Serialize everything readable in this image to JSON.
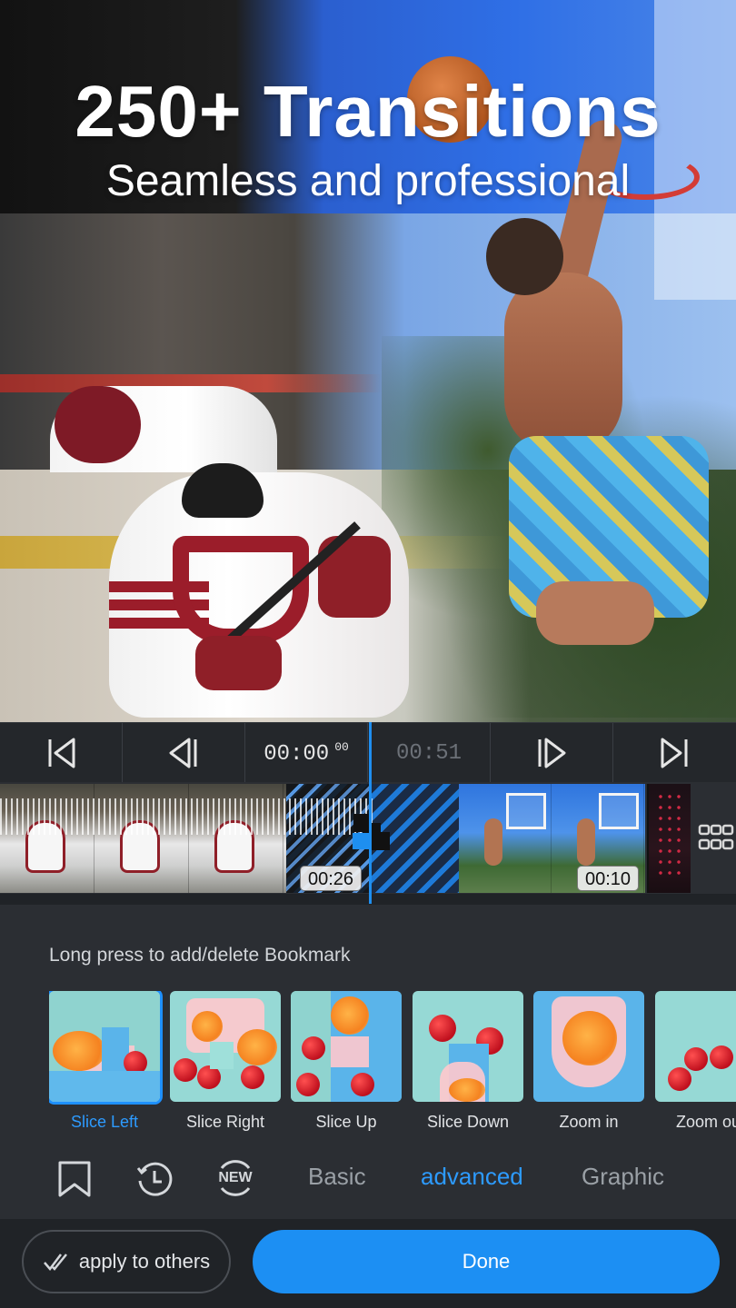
{
  "hero": {
    "title": "250+ Transitions",
    "subtitle": "Seamless and professional"
  },
  "playback": {
    "current_time": "00:00",
    "current_frames": "00",
    "duration": "00:51",
    "icons": [
      "skip-to-start-icon",
      "prev-frame-icon",
      "next-frame-icon",
      "skip-to-end-icon"
    ]
  },
  "timeline": {
    "clip1_duration": "00:26",
    "clip2_duration": "00:10"
  },
  "panel": {
    "hint": "Long press to add/delete Bookmark",
    "transitions": [
      {
        "label": "Slice Left",
        "selected": true
      },
      {
        "label": "Slice Right",
        "selected": false
      },
      {
        "label": "Slice Up",
        "selected": false
      },
      {
        "label": "Slice Down",
        "selected": false
      },
      {
        "label": "Zoom in",
        "selected": false
      },
      {
        "label": "Zoom out",
        "selected": false
      }
    ],
    "new_badge": "NEW",
    "categories": [
      {
        "label": "Basic",
        "active": false
      },
      {
        "label": "advanced",
        "active": true
      },
      {
        "label": "Graphic",
        "active": false
      }
    ]
  },
  "footer": {
    "apply_label": "apply to others",
    "done_label": "Done"
  },
  "colors": {
    "accent": "#1c8ff3",
    "selected_text": "#2d9bff",
    "panel_bg": "#2b2e33"
  }
}
